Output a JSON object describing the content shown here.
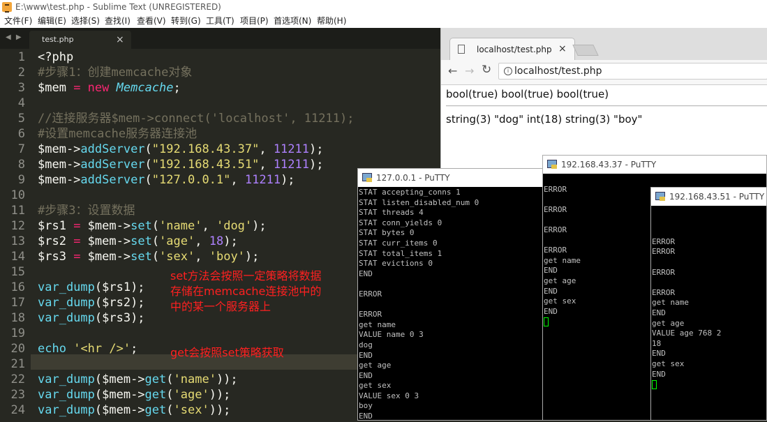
{
  "window": {
    "title": "E:\\www\\test.php - Sublime Text (UNREGISTERED)"
  },
  "menu": [
    "文件(F)",
    "编辑(E)",
    "选择(S)",
    "查找(I)",
    "查看(V)",
    "转到(G)",
    "工具(T)",
    "项目(P)",
    "首选项(N)",
    "帮助(H)"
  ],
  "tab": {
    "label": "test.php",
    "close": "×",
    "arrows": "◀ ▶"
  },
  "line_numbers": [
    "1",
    "2",
    "3",
    "4",
    "5",
    "6",
    "7",
    "8",
    "9",
    "10",
    "11",
    "12",
    "13",
    "14",
    "15",
    "16",
    "17",
    "18",
    "19",
    "20",
    "21",
    "22",
    "23",
    "24"
  ],
  "code": {
    "l1": "<?php",
    "l2": "#步骤1：创建memcache对象",
    "l3a": "$mem",
    "l3b": " = ",
    "l3c": "new",
    "l3d": " ",
    "l3e": "Memcache",
    "l3f": ";",
    "l5": "//连接服务器$mem->connect('localhost', 11211);",
    "l6": "#设置memcache服务器连接池",
    "l7a": "$mem->",
    "l7b": "addServer",
    "l7c": "(",
    "l7d": "\"192.168.43.37\"",
    "l7e": ", ",
    "l7f": "11211",
    "l7g": ");",
    "l8a": "$mem->",
    "l8b": "addServer",
    "l8c": "(",
    "l8d": "\"192.168.43.51\"",
    "l8e": ", ",
    "l8f": "11211",
    "l8g": ");",
    "l9a": "$mem->",
    "l9b": "addServer",
    "l9c": "(",
    "l9d": "\"127.0.0.1\"",
    "l9e": ", ",
    "l9f": "11211",
    "l9g": ");",
    "l11": "#步骤3：设置数据",
    "l12a": "$rs1",
    "l12b": " = ",
    "l12c": "$mem->",
    "l12d": "set",
    "l12e": "(",
    "l12f": "'name'",
    "l12g": ", ",
    "l12h": "'dog'",
    "l12i": ");",
    "l13a": "$rs2",
    "l13b": " = ",
    "l13c": "$mem->",
    "l13d": "set",
    "l13e": "(",
    "l13f": "'age'",
    "l13g": ", ",
    "l13h": "18",
    "l13i": ");",
    "l14a": "$rs3",
    "l14b": " = ",
    "l14c": "$mem->",
    "l14d": "set",
    "l14e": "(",
    "l14f": "'sex'",
    "l14g": ", ",
    "l14h": "'boy'",
    "l14i": ");",
    "l16a": "var_dump",
    "l16b": "($rs1);",
    "l17a": "var_dump",
    "l17b": "($rs2);",
    "l18a": "var_dump",
    "l18b": "($rs3);",
    "l20a": "echo",
    "l20b": " ",
    "l20c": "'<hr />'",
    "l20d": ";",
    "l22a": "var_dump",
    "l22b": "($mem->",
    "l22c": "get",
    "l22d": "(",
    "l22e": "'name'",
    "l22f": "));",
    "l23a": "var_dump",
    "l23b": "($mem->",
    "l23c": "get",
    "l23d": "(",
    "l23e": "'age'",
    "l23f": "));",
    "l24a": "var_dump",
    "l24b": "($mem->",
    "l24c": "get",
    "l24d": "(",
    "l24e": "'sex'",
    "l24f": "));"
  },
  "notes": {
    "set1": "set方法会按照一定策略将数据",
    "set2": "存储在memcache连接池中的",
    "set3": "中的某一个服务器上",
    "get": "get会按照set策略获取"
  },
  "chrome": {
    "tab": "localhost/test.php",
    "close": "×",
    "url": "localhost/test.php",
    "out1": "bool(true) bool(true) bool(true)",
    "out2": "string(3) \"dog\" int(18) string(3) \"boy\"",
    "back": "←",
    "fwd": "→",
    "reload": "↻",
    "info": "i"
  },
  "putty1": {
    "title": "127.0.0.1 - PuTTY",
    "lines": "STAT accepting_conns 1\nSTAT listen_disabled_num 0\nSTAT threads 4\nSTAT conn_yields 0\nSTAT bytes 0\nSTAT curr_items 0\nSTAT total_items 1\nSTAT evictions 0\nEND\n\nERROR\n\nERROR\nget name\nVALUE name 0 3\ndog\nEND\nget age\nEND\nget sex\nVALUE sex 0 3\nboy\nEND"
  },
  "putty2": {
    "title": "192.168.43.37 - PuTTY",
    "lines": "\nERROR\n\nERROR\n\nERROR\n\nERROR\nget name\nEND\nget age\nEND\nget sex\nEND"
  },
  "putty3": {
    "title": "192.168.43.51 - PuTTY",
    "lines": "\n\n\nERROR\nERROR\n\nERROR\n\nERROR\nget name\nEND\nget age\nVALUE age 768 2\n18\nEND\nget sex\nEND"
  }
}
